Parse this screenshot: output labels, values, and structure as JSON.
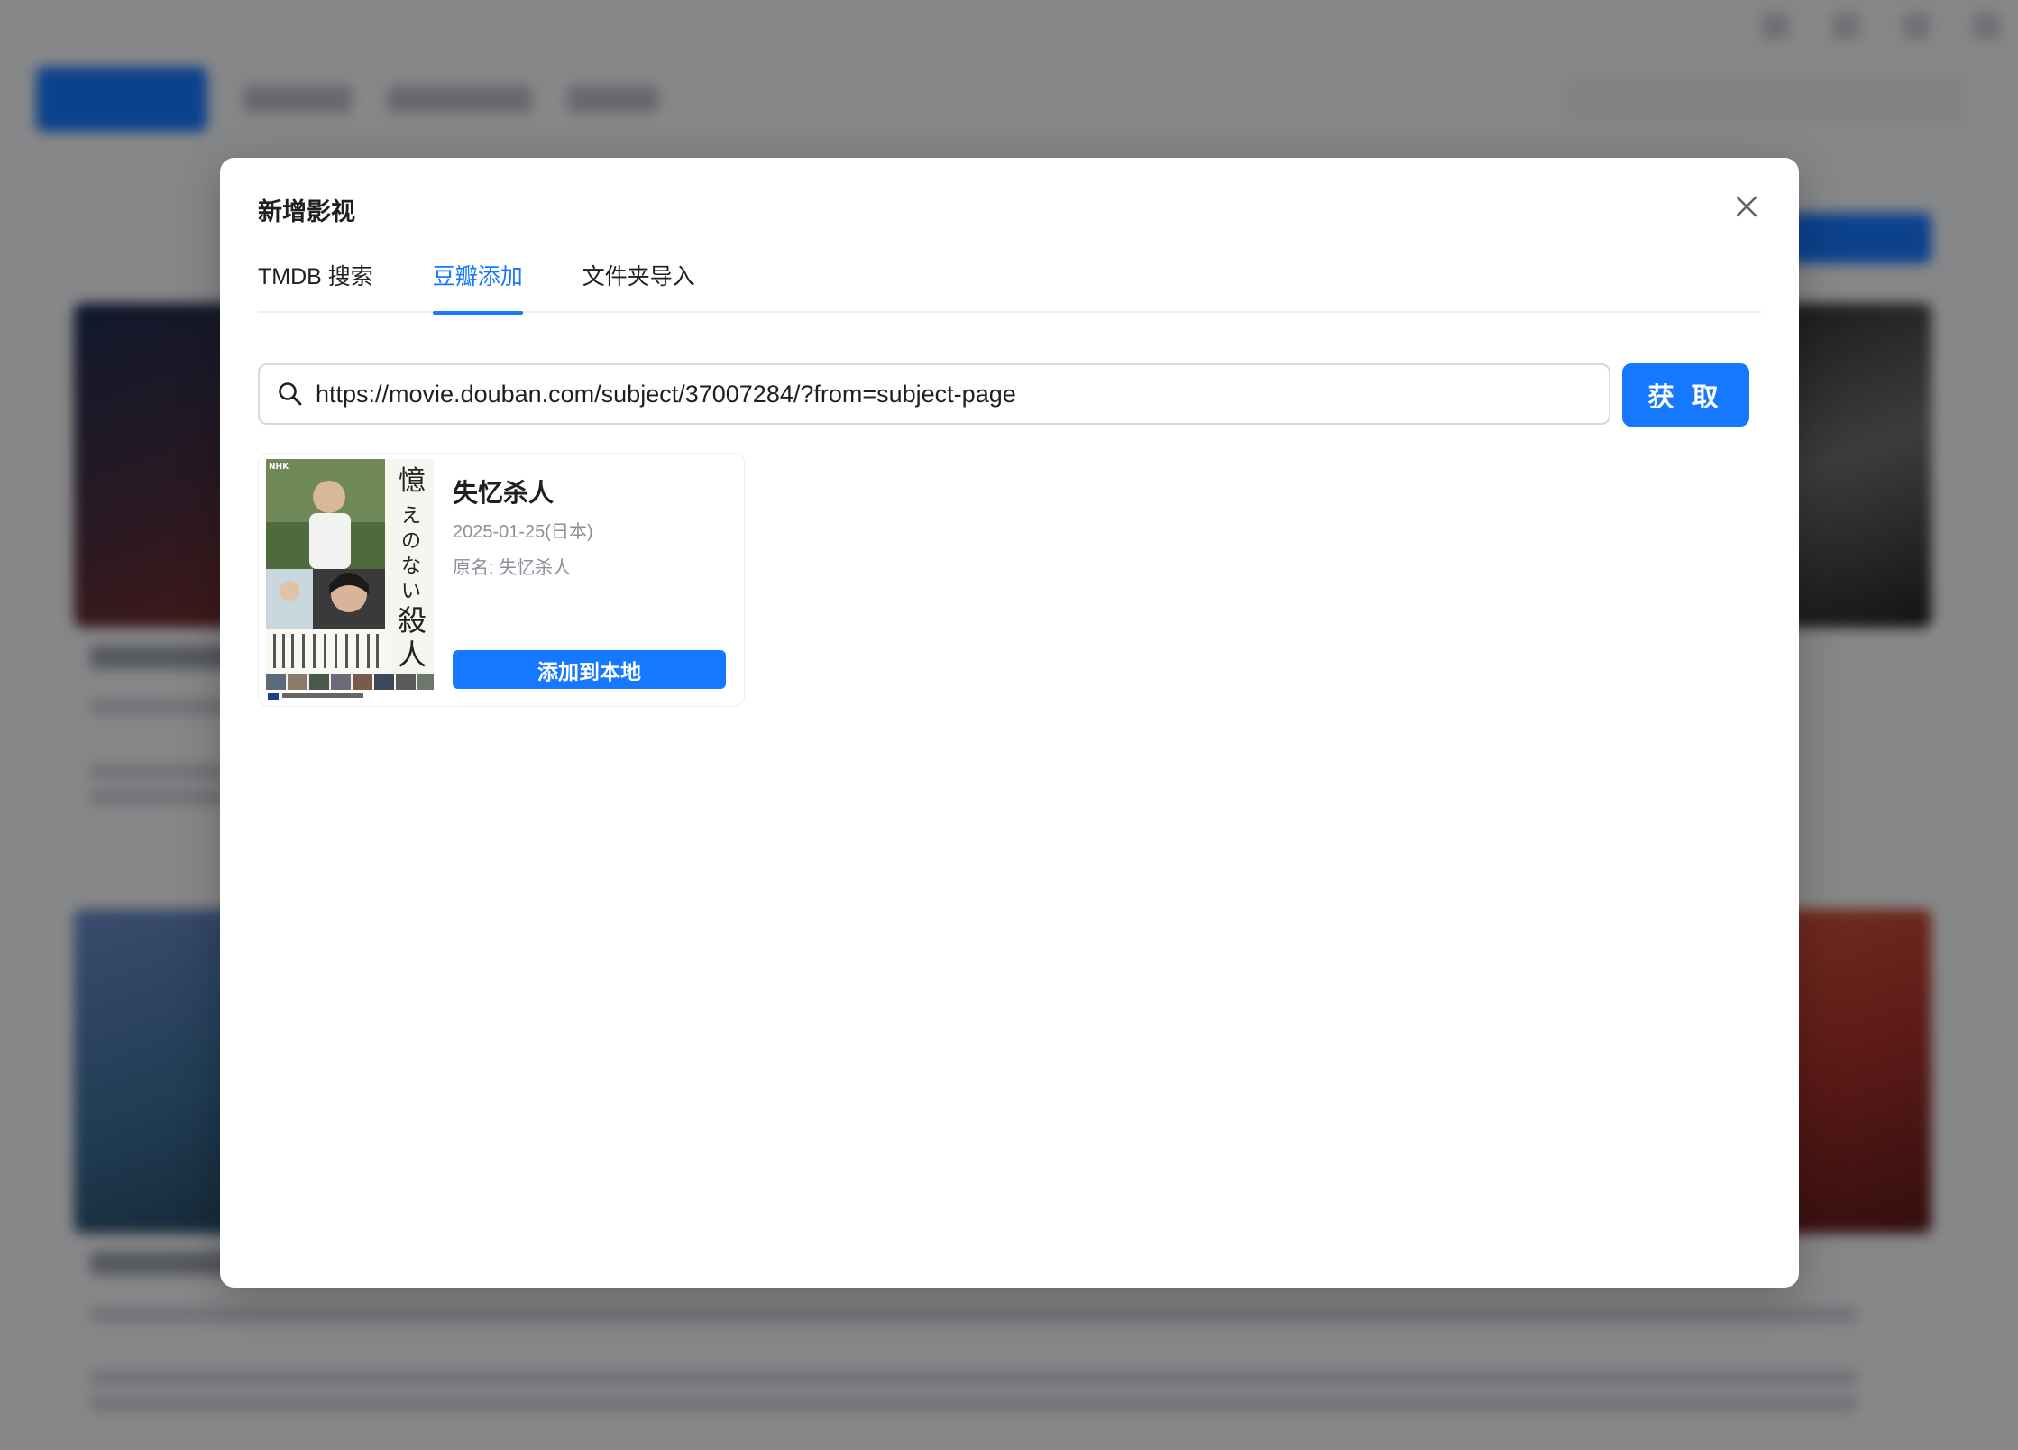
{
  "modal": {
    "title": "新增影视",
    "close_icon": "close-icon"
  },
  "tabs": [
    {
      "label": "TMDB 搜索",
      "active": false
    },
    {
      "label": "豆瓣添加",
      "active": true
    },
    {
      "label": "文件夹导入",
      "active": false
    }
  ],
  "search": {
    "icon": "search-icon",
    "value": "https://movie.douban.com/subject/37007284/?from=subject-page",
    "placeholder": ""
  },
  "fetch_button": {
    "label": "获 取"
  },
  "result": {
    "title": "失忆杀人",
    "date": "2025-01-25(日本)",
    "original_name": "原名: 失忆杀人",
    "add_button": "添加到本地",
    "poster": {
      "brand": "NHK",
      "title_art": "憶えのない殺人"
    }
  },
  "colors": {
    "primary": "#1677ff",
    "text": "#1f1f1f",
    "muted": "#8a8f99"
  }
}
